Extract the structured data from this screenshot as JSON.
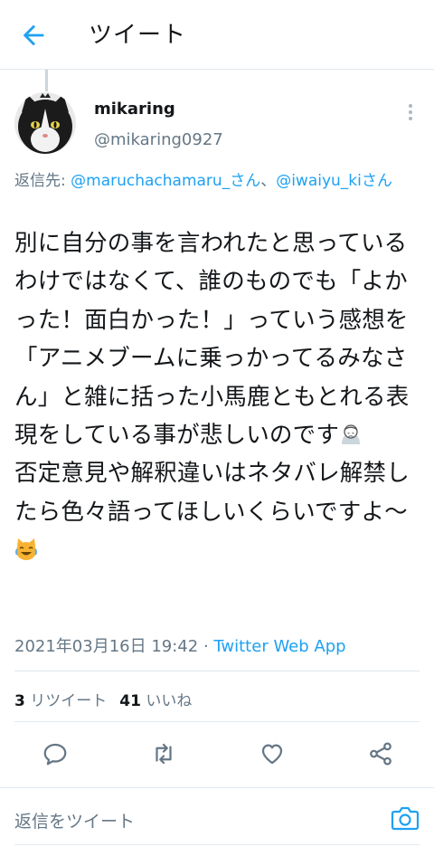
{
  "header": {
    "title": "ツイート",
    "back_icon": "arrow-left-icon"
  },
  "author": {
    "display_name": "mikaring",
    "handle": "@mikaring0927",
    "avatar": "cat-avatar"
  },
  "reply_to": {
    "prefix": "返信先: ",
    "mention1": "@maruchachamaru_さん",
    "separator": "、",
    "mention2": "@iwaiyu_kiさん"
  },
  "tweet": {
    "text_part1": "別に自分の事を言われたと思っているわけではなくて、誰のものでも「よかった！面白かった！」っていう感想を「アニメブームに乗っかってるみなさん」と雑に括った小馬鹿ともとれる表現をしている事が悲しいのです",
    "text_part2": "否定意見や解釈違いはネタバレ解禁したら色々語ってほしいくらいですよ〜",
    "emoji1": "sad-woman-emoji",
    "emoji2": "laughing-cat-emoji"
  },
  "meta": {
    "datetime": "2021年03月16日 19:42",
    "dot": " · ",
    "source": "Twitter Web App"
  },
  "stats": {
    "retweets_count": "3",
    "retweets_label": "リツイート",
    "likes_count": "41",
    "likes_label": "いいね"
  },
  "actions": [
    "reply-icon",
    "retweet-icon",
    "like-icon",
    "share-icon"
  ],
  "reply_bar": {
    "placeholder": "返信をツイート",
    "camera_icon": "camera-icon"
  },
  "colors": {
    "accent": "#1da1f2",
    "secondary_text": "#657786",
    "border": "#e1e8ed"
  }
}
